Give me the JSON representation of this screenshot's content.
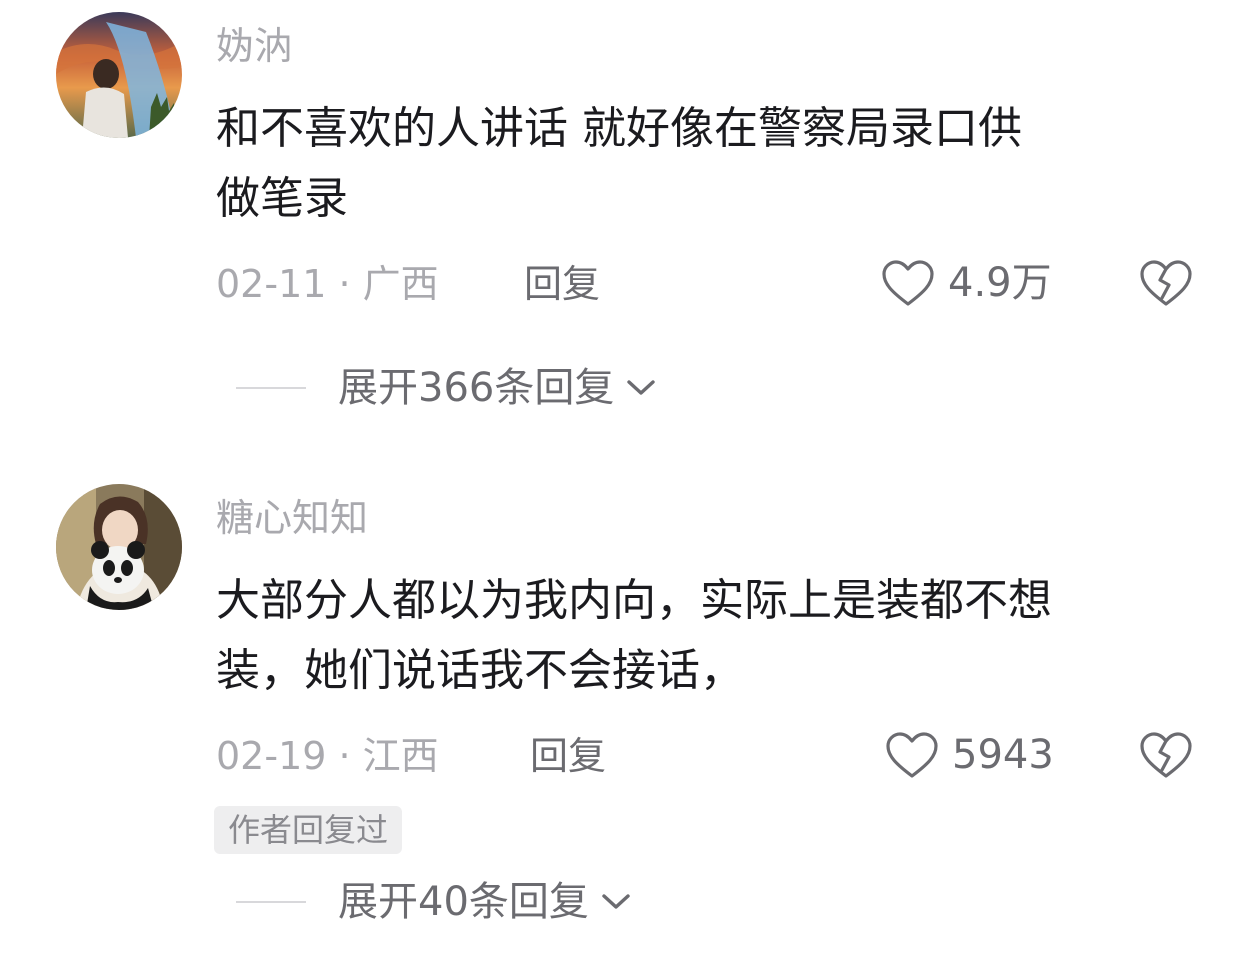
{
  "comments": [
    {
      "username": "妫汭",
      "text_line1": "和不喜欢的人讲话 就好像在警察局录口供",
      "text_line2": "做笔录",
      "date_location": "02-11 · 广西",
      "reply_label": "回复",
      "like_count": "4.9万",
      "expand_label": "展开366条回复",
      "avatar_icon": "avatar-sunset-photo",
      "like_icon": "heart-outline-icon",
      "dislike_icon": "broken-heart-icon",
      "expand_icon": "chevron-down-icon"
    },
    {
      "username": "糖心知知",
      "text_line1": "大部分人都以为我内向，实际上是装都不想",
      "text_line2": "装，她们说话我不会接话，",
      "date_location": "02-19 · 江西",
      "reply_label": "回复",
      "like_count": "5943",
      "author_badge": "作者回复过",
      "expand_label": "展开40条回复",
      "avatar_icon": "avatar-panda-photo",
      "like_icon": "heart-outline-icon",
      "dislike_icon": "broken-heart-icon",
      "expand_icon": "chevron-down-icon"
    }
  ],
  "colors": {
    "username": "#a9a9ae",
    "text": "#1b1b1f",
    "secondary": "#6b6b70",
    "badge_bg": "#eeeeef"
  }
}
